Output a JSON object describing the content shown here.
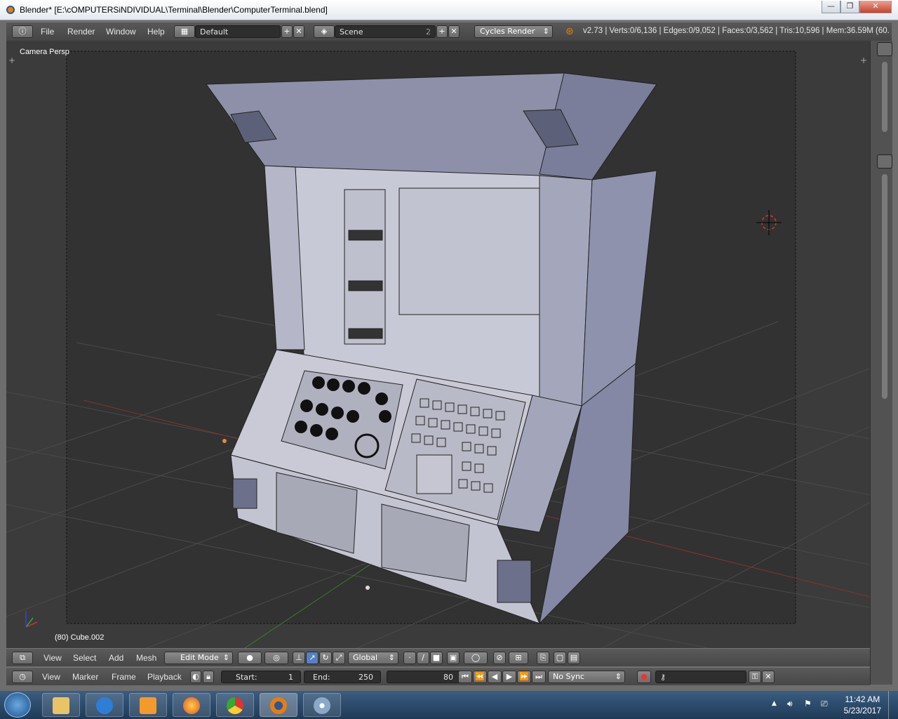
{
  "window": {
    "title": "Blender* [E:\\cOMPUTERSiNDIVIDUAL\\Terminal\\Blender\\ComputerTerminal.blend]",
    "controls": {
      "minimize": "—",
      "maximize": "❐",
      "close": "✕"
    }
  },
  "info_header": {
    "menus": [
      "File",
      "Render",
      "Window",
      "Help"
    ],
    "layout": "Default",
    "scene": "Scene",
    "scene_users": "2",
    "render_engine": "Cycles Render",
    "stats": "v2.73 | Verts:0/6,136 | Edges:0/9,052 | Faces:0/3,562 | Tris:10,596 | Mem:36.59M (60."
  },
  "viewport": {
    "view_name": "Camera Persp",
    "object_info": "(80) Cube.002"
  },
  "view3d_header": {
    "menus": [
      "View",
      "Select",
      "Add",
      "Mesh"
    ],
    "mode": "Edit Mode",
    "orientation": "Global"
  },
  "timeline_header": {
    "menus": [
      "View",
      "Marker",
      "Frame",
      "Playback"
    ],
    "start_label": "Start:",
    "start_value": "1",
    "end_label": "End:",
    "end_value": "250",
    "current_frame": "80",
    "sync": "No Sync"
  },
  "taskbar": {
    "time": "11:42 AM",
    "date": "5/23/2017",
    "apps": [
      "explorer-icon",
      "internet-explorer-icon",
      "media-player-icon",
      "firefox-icon",
      "chrome-icon",
      "blender-icon",
      "paint-icon"
    ]
  },
  "colors": {
    "blender_header": "#4f4f4f",
    "viewport_bg": "#3b3b3b",
    "mesh_face": "#b6b8cc",
    "taskbar": "#2a4a6c"
  }
}
